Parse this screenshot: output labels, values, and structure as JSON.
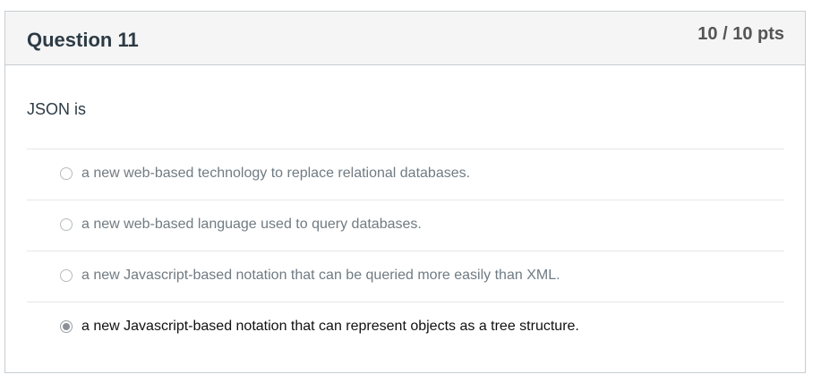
{
  "question": {
    "title": "Question 11",
    "points": "10 / 10 pts",
    "text": "JSON is",
    "answers": [
      {
        "label": "a new web-based technology to replace relational databases.",
        "selected": false
      },
      {
        "label": "a new web-based language used to query databases.",
        "selected": false
      },
      {
        "label": "a new Javascript-based notation that can be queried more easily than XML.",
        "selected": false
      },
      {
        "label": "a new Javascript-based notation that can represent objects as a tree structure.",
        "selected": true
      }
    ]
  }
}
